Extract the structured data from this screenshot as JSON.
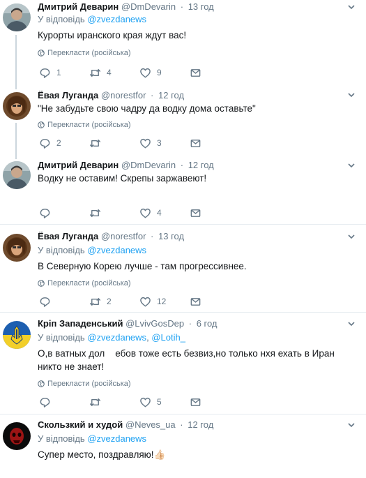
{
  "common": {
    "translate_label": "Перекласти (російська)",
    "dot": "·",
    "reply_prefix": "У відповідь",
    "reply_join": ","
  },
  "tweets": [
    {
      "name": "Дмитрий Деварин",
      "handle": "@DmDevarin",
      "time": "13 год",
      "reply_to": [
        "@zvezdanews"
      ],
      "text": "Курорты иранского края ждут вас!",
      "replies": "1",
      "retweets": "4",
      "likes": "9"
    },
    {
      "name": "Ёвая Луганда",
      "handle": "@norestfor",
      "time": "12 год",
      "reply_to": [],
      "text": "\"Не забудьте свою чадру да водку дома оставьте\"",
      "replies": "2",
      "retweets": "",
      "likes": "3"
    },
    {
      "name": "Дмитрий Деварин",
      "handle": "@DmDevarin",
      "time": "12 год",
      "reply_to": [],
      "text": "Водку не оставим! Скрепы заржавеют!",
      "replies": "",
      "retweets": "",
      "likes": "4"
    },
    {
      "name": "Ёвая Луганда",
      "handle": "@norestfor",
      "time": "13 год",
      "reply_to": [
        "@zvezdanews"
      ],
      "text": "В Северную Корею лучше - там прогрессивнее.",
      "replies": "",
      "retweets": "2",
      "likes": "12"
    },
    {
      "name": "Кріп Западенський",
      "handle": "@LvivGosDep",
      "time": "6 год",
      "reply_to": [
        "@zvezdanews",
        "@Lotih_"
      ],
      "text": "О,в ватных дол    ебов тоже есть безвиз,но только нхя ехать в Иран никто не знает!",
      "replies": "",
      "retweets": "",
      "likes": "5"
    },
    {
      "name": "Скользкий и худой",
      "handle": "@Neves_ua",
      "time": "12 год",
      "reply_to": [
        "@zvezdanews"
      ],
      "text": "Супер место, поздравляю!👍🏻"
    }
  ],
  "icons": {
    "reply": "reply-icon",
    "retweet": "retweet-icon",
    "like": "heart-icon",
    "dm": "envelope-icon",
    "globe": "globe-icon",
    "caret": "chevron-down-icon"
  },
  "colors": {
    "mention": "#1da1f2",
    "muted": "#657786",
    "text": "#14171a",
    "thread_line": "#ccd6dd",
    "separator": "#e6ecf0"
  }
}
